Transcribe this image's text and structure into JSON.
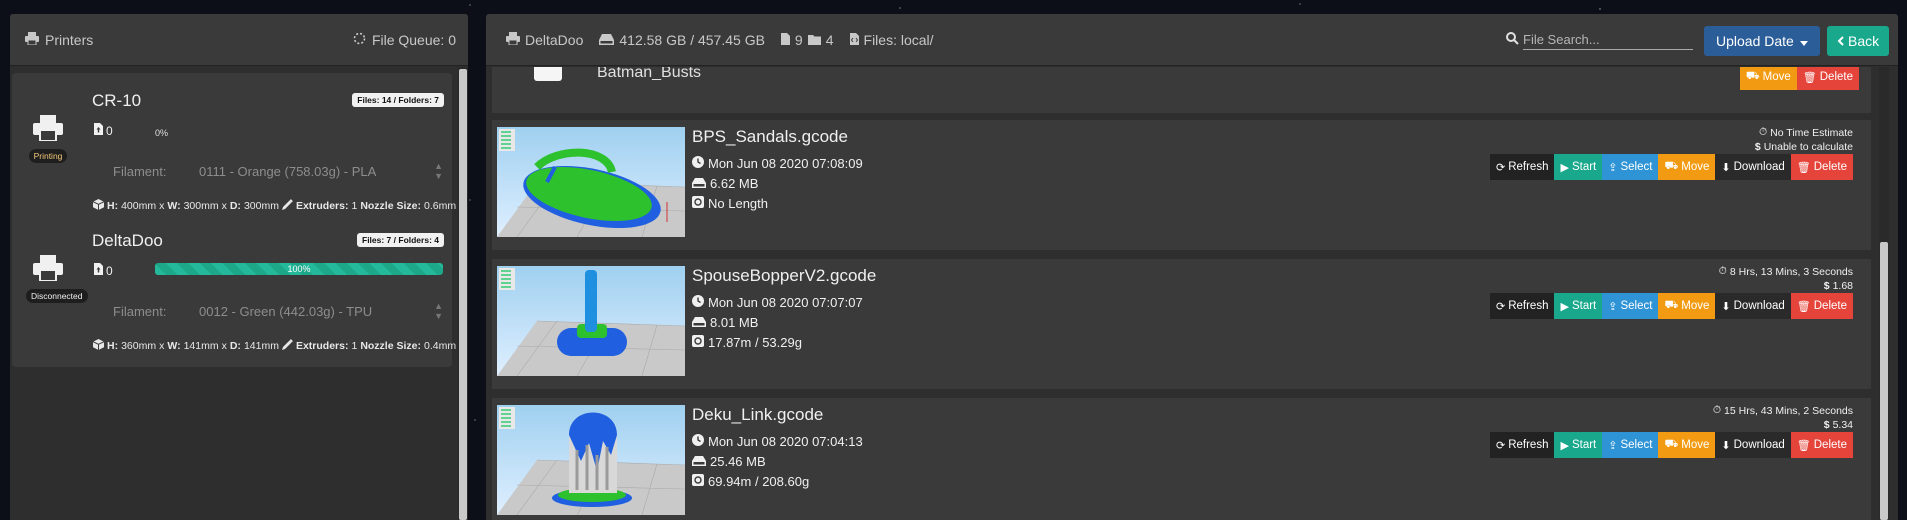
{
  "left_header": {
    "title": "Printers",
    "queue_label": "File Queue: 0"
  },
  "printers": [
    {
      "name": "CR-10",
      "status": "Printing",
      "files_badge": "Files: 14 / Folders: 7",
      "queue_count": "0",
      "progress_text": "0%",
      "progress": 0,
      "filament_label": "Filament:",
      "filament_value": "0111 - Orange (758.03g) - PLA",
      "spec_h": "400mm",
      "spec_w": "300mm",
      "spec_d": "300mm",
      "extruders": "1",
      "nozzle": "0.6mm"
    },
    {
      "name": "DeltaDoo",
      "status": "Disconnected",
      "files_badge": "Files: 7 / Folders: 4",
      "queue_count": "0",
      "progress_text": "100%",
      "progress": 100,
      "filament_label": "Filament:",
      "filament_value": "0012 - Green (442.03g) - TPU",
      "spec_h": "360mm",
      "spec_w": "141mm",
      "spec_d": "141mm",
      "extruders": "1",
      "nozzle": "0.4mm"
    }
  ],
  "spec_labels": {
    "h": "H:",
    "x1": "x",
    "w": "W:",
    "x2": "x",
    "d": "D:",
    "extruders": "Extruders:",
    "nozzle": "Nozzle Size:"
  },
  "main_header": {
    "printer": "DeltaDoo",
    "storage": "412.58 GB / 457.45 GB",
    "file_count": "9",
    "folder_count": "4",
    "path": "Files: local/",
    "search_placeholder": "File Search...",
    "sort_label": "Upload Date",
    "back_label": "Back"
  },
  "folder": {
    "name": "Batman_Busts",
    "move": "Move",
    "delete": "Delete"
  },
  "buttons": {
    "refresh": "Refresh",
    "start": "Start",
    "select": "Select",
    "move": "Move",
    "download": "Download",
    "delete": "Delete"
  },
  "files": [
    {
      "name": "BPS_Sandals.gcode",
      "date": "Mon Jun 08 2020 07:08:09",
      "size": "6.62 MB",
      "usage": "No Length",
      "time_est": "No Time Estimate",
      "cost": "Unable to calculate"
    },
    {
      "name": "SpouseBopperV2.gcode",
      "date": "Mon Jun 08 2020 07:07:07",
      "size": "8.01 MB",
      "usage": "17.87m / 53.29g",
      "time_est": "8 Hrs, 13 Mins, 3 Seconds",
      "cost": "1.68"
    },
    {
      "name": "Deku_Link.gcode",
      "date": "Mon Jun 08 2020 07:04:13",
      "size": "25.46 MB",
      "usage": "69.94m / 208.60g",
      "time_est": "15 Hrs, 43 Mins, 2 Seconds",
      "cost": "5.34"
    }
  ],
  "colors": {
    "panel": "#2e2e2e",
    "card": "#3a3a3a",
    "start": "#1aa88c",
    "select": "#2f94d6",
    "move": "#f29b12",
    "delete": "#e5443a",
    "sort": "#2b5d99",
    "progress": "#25b99b"
  }
}
